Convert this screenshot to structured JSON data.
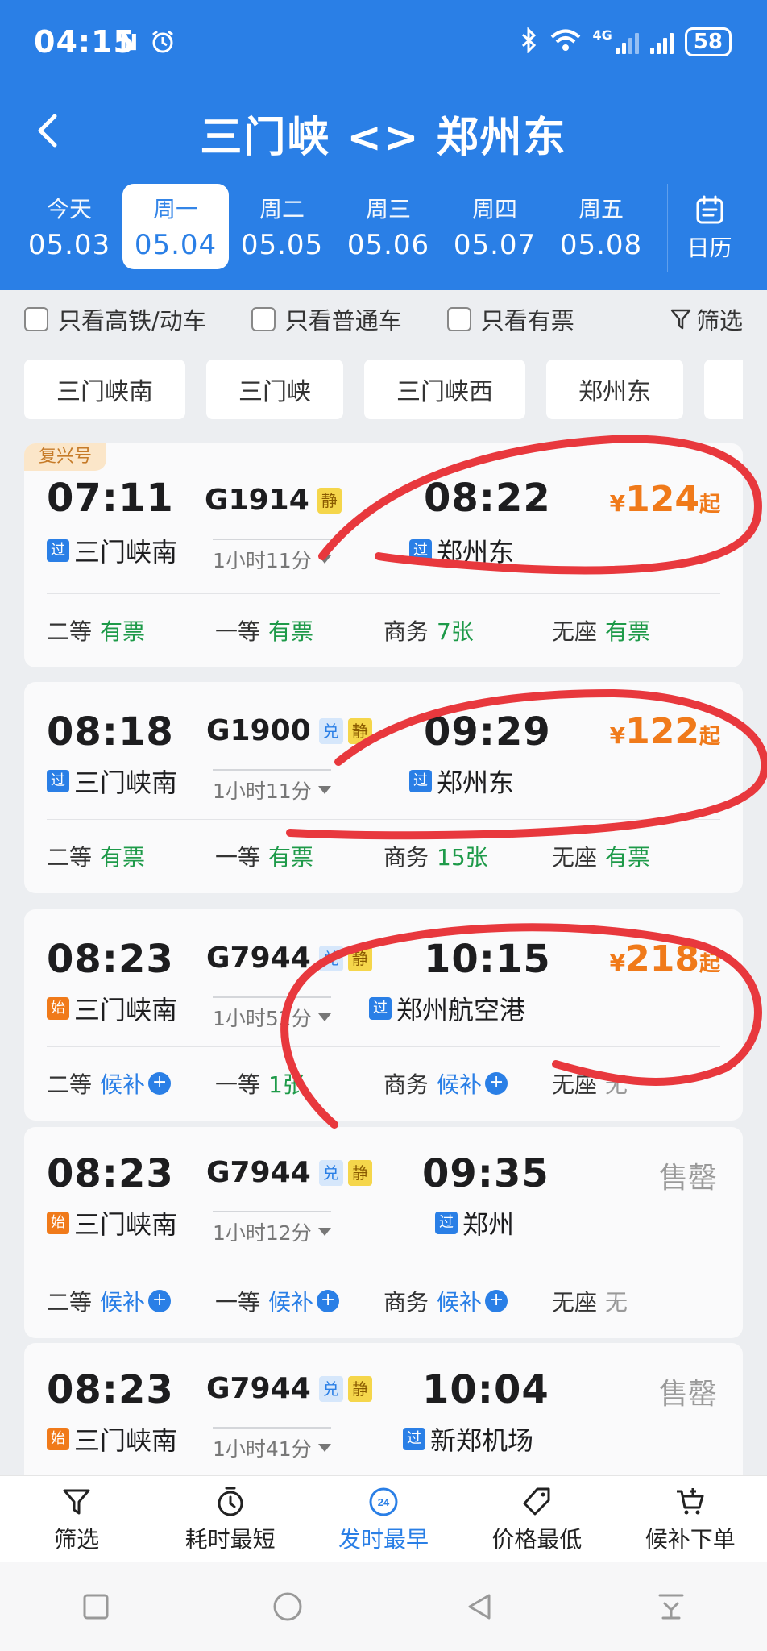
{
  "status_bar": {
    "time": "04:15",
    "nfc_icon": "N",
    "battery": "58",
    "network": "4G"
  },
  "header": {
    "title": "三门峡 <> 郑州东",
    "dates": [
      {
        "weekday": "今天",
        "date": "05.03"
      },
      {
        "weekday": "周一",
        "date": "05.04",
        "active": true
      },
      {
        "weekday": "周二",
        "date": "05.05"
      },
      {
        "weekday": "周三",
        "date": "05.06"
      },
      {
        "weekday": "周四",
        "date": "05.07"
      },
      {
        "weekday": "周五",
        "date": "05.08"
      }
    ],
    "calendar_label": "日历"
  },
  "filters": {
    "gaotie": "只看高铁/动车",
    "putong": "只看普通车",
    "youpiao": "只看有票",
    "filter": "筛选"
  },
  "stations": [
    "三门峡南",
    "三门峡",
    "三门峡西",
    "郑州东"
  ],
  "trains": [
    {
      "badge": "复兴号",
      "dep_time": "07:11",
      "dep_tag": "过",
      "dep_station": "三门峡南",
      "train_no": "G1914",
      "chips": [
        "静"
      ],
      "duration": "1小时11分",
      "arr_time": "08:22",
      "arr_tag": "过",
      "arr_station": "郑州东",
      "price_symbol": "¥",
      "price": "124",
      "price_suffix": "起",
      "seats": [
        {
          "label": "二等",
          "value": "有票"
        },
        {
          "label": "一等",
          "value": "有票"
        },
        {
          "label": "商务",
          "value": "7张"
        },
        {
          "label": "无座",
          "value": "有票"
        }
      ]
    },
    {
      "dep_time": "08:18",
      "dep_tag": "过",
      "dep_station": "三门峡南",
      "train_no": "G1900",
      "chips": [
        "兑",
        "静"
      ],
      "duration": "1小时11分",
      "arr_time": "09:29",
      "arr_tag": "过",
      "arr_station": "郑州东",
      "price_symbol": "¥",
      "price": "122",
      "price_suffix": "起",
      "seats": [
        {
          "label": "二等",
          "value": "有票"
        },
        {
          "label": "一等",
          "value": "有票"
        },
        {
          "label": "商务",
          "value": "15张"
        },
        {
          "label": "无座",
          "value": "有票"
        }
      ]
    },
    {
      "dep_time": "08:23",
      "dep_tag": "始",
      "dep_station": "三门峡南",
      "train_no": "G7944",
      "chips": [
        "兑",
        "静"
      ],
      "duration": "1小时52分",
      "arr_time": "10:15",
      "arr_tag": "过",
      "arr_station": "郑州航空港",
      "price_symbol": "¥",
      "price": "218",
      "price_suffix": "起",
      "seats": [
        {
          "label": "二等",
          "value": "候补"
        },
        {
          "label": "一等",
          "value": "1张"
        },
        {
          "label": "商务",
          "value": "候补"
        },
        {
          "label": "无座",
          "value": "无"
        }
      ]
    },
    {
      "dep_time": "08:23",
      "dep_tag": "始",
      "dep_station": "三门峡南",
      "train_no": "G7944",
      "chips": [
        "兑",
        "静"
      ],
      "duration": "1小时12分",
      "arr_time": "09:35",
      "arr_tag": "过",
      "arr_station": "郑州",
      "soldout": "售罄",
      "seats": [
        {
          "label": "二等",
          "value": "候补"
        },
        {
          "label": "一等",
          "value": "候补"
        },
        {
          "label": "商务",
          "value": "候补"
        },
        {
          "label": "无座",
          "value": "无"
        }
      ]
    },
    {
      "dep_time": "08:23",
      "dep_tag": "始",
      "dep_station": "三门峡南",
      "train_no": "G7944",
      "chips": [
        "兑",
        "静"
      ],
      "duration": "1小时41分",
      "arr_time": "10:04",
      "arr_tag": "过",
      "arr_station": "新郑机场",
      "soldout": "售罄"
    }
  ],
  "bottom_bar": [
    {
      "label": "筛选",
      "icon": "funnel-icon"
    },
    {
      "label": "耗时最短",
      "icon": "stopwatch-icon"
    },
    {
      "label": "发时最早",
      "icon": "clock-24-icon",
      "active": true,
      "icon_text": "24"
    },
    {
      "label": "价格最低",
      "icon": "price-tag-icon"
    },
    {
      "label": "候补下单",
      "icon": "cart-plus-icon"
    }
  ],
  "colors": {
    "brand_blue": "#2a7fe6",
    "price_orange": "#f07a1a",
    "available_green": "#1e9a49",
    "annotation_red": "#e8383d"
  }
}
